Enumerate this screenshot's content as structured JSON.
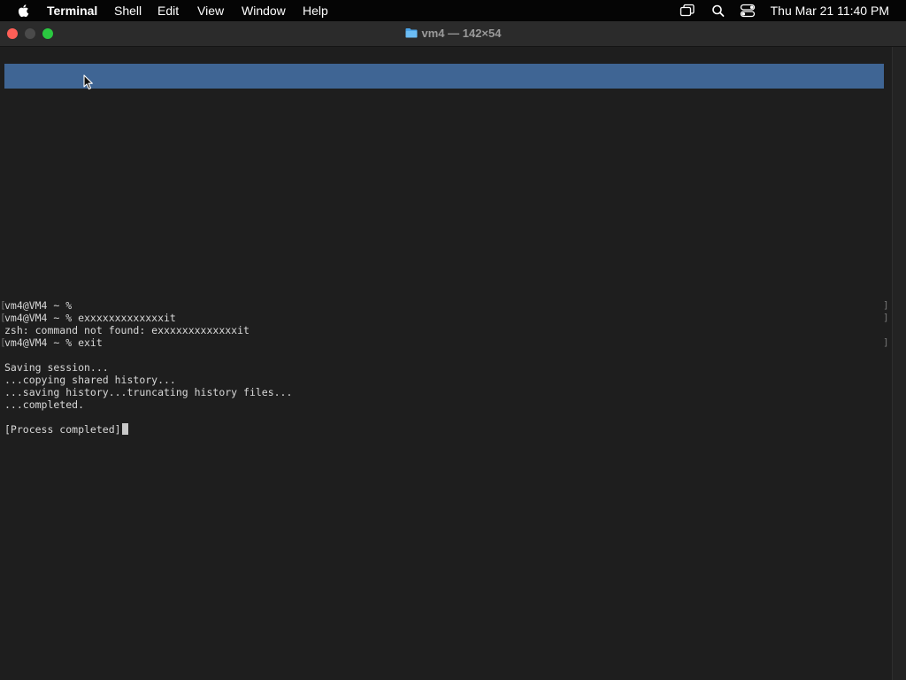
{
  "menubar": {
    "app_name": "Terminal",
    "items": [
      "Shell",
      "Edit",
      "View",
      "Window",
      "Help"
    ],
    "clock": "Thu Mar 21  11:40 PM"
  },
  "window": {
    "title": "vm4 — 142×54"
  },
  "terminal": {
    "lines": [
      "vm4@VM4 ~ % ",
      "vm4@VM4 ~ % exxxxxxxxxxxxxit",
      "zsh: command not found: exxxxxxxxxxxxxit",
      "vm4@VM4 ~ % exit",
      "",
      "Saving session...",
      "...copying shared history...",
      "...saving history...truncating history files...",
      "...completed.",
      "",
      "[Process completed]"
    ]
  },
  "colors": {
    "selection": "#3f6594",
    "close": "#fe5f57",
    "zoom": "#2ac840",
    "terminal_bg": "#1e1e1e"
  },
  "icons": {
    "apple": "apple-logo-icon",
    "folder": "folder-icon",
    "screen_mirroring": "screen-mirroring-icon",
    "spotlight": "search-icon",
    "control_center": "control-center-icon",
    "pointer": "mouse-pointer-icon"
  }
}
